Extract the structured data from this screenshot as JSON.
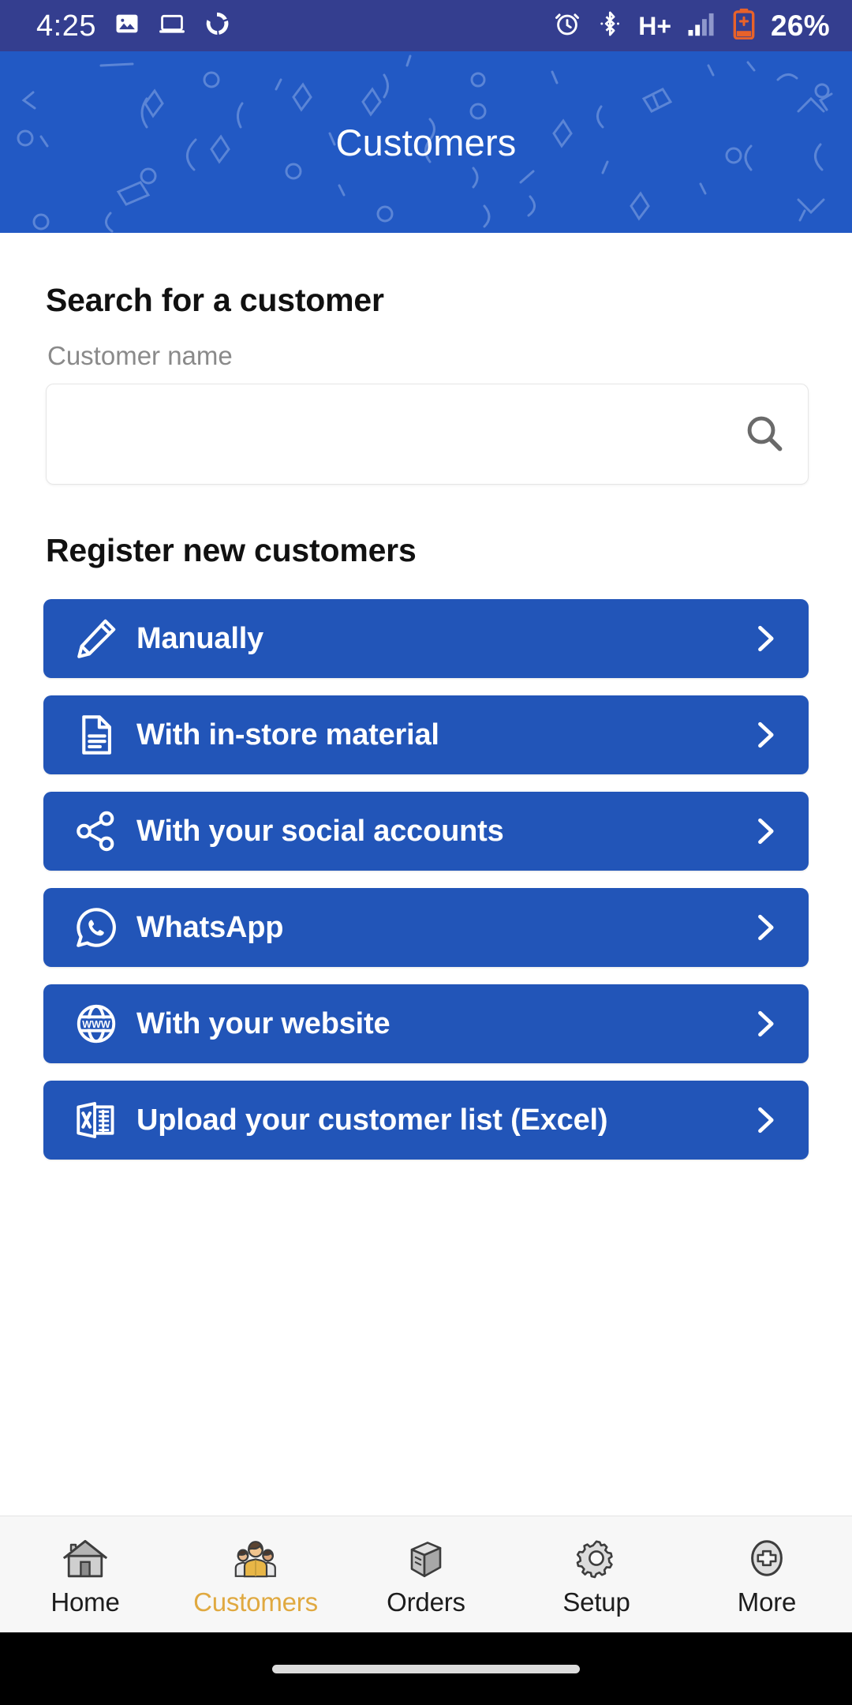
{
  "status_bar": {
    "time": "4:25",
    "battery_percent": "26%",
    "network_type": "H+",
    "left_icons": [
      "image-icon",
      "laptop-icon",
      "sync-icon"
    ],
    "right_icons": [
      "alarm-icon",
      "bluetooth-icon",
      "network-h-plus-icon",
      "signal-bars-icon",
      "battery-charging-icon"
    ],
    "bg_color": "#343e8f",
    "battery_color": "#e8622a"
  },
  "header": {
    "title": "Customers",
    "bg_color": "#2259c4"
  },
  "search_section": {
    "title": "Search for a customer",
    "field_label": "Customer name",
    "input_value": "",
    "input_placeholder": "",
    "search_icon": "search-icon"
  },
  "register_section": {
    "title": "Register new customers",
    "accent_color": "#2255b8",
    "buttons": [
      {
        "label": "Manually",
        "icon": "pencil-icon",
        "chevron": "chevron-right-icon"
      },
      {
        "label": "With in-store material",
        "icon": "document-icon",
        "chevron": "chevron-right-icon"
      },
      {
        "label": "With your social accounts",
        "icon": "share-icon",
        "chevron": "chevron-right-icon"
      },
      {
        "label": "WhatsApp",
        "icon": "whatsapp-icon",
        "chevron": "chevron-right-icon"
      },
      {
        "label": "With your website",
        "icon": "globe-www-icon",
        "chevron": "chevron-right-icon"
      },
      {
        "label": "Upload your customer list (Excel)",
        "icon": "excel-file-icon",
        "chevron": "chevron-right-icon"
      }
    ]
  },
  "bottom_nav": {
    "active_color": "#e0a940",
    "items": [
      {
        "label": "Home",
        "icon": "house-icon",
        "active": false
      },
      {
        "label": "Customers",
        "icon": "people-icon",
        "active": true
      },
      {
        "label": "Orders",
        "icon": "box-icon",
        "active": false
      },
      {
        "label": "Setup",
        "icon": "gear-icon",
        "active": false
      },
      {
        "label": "More",
        "icon": "plus-circle-icon",
        "active": false
      }
    ]
  }
}
